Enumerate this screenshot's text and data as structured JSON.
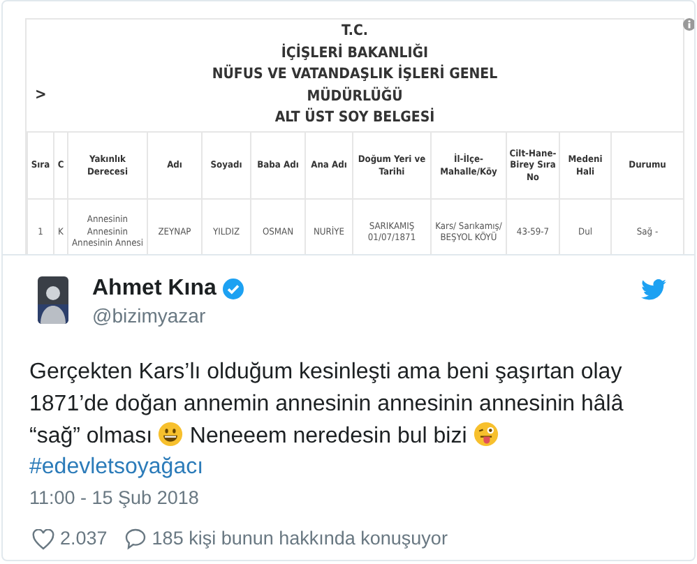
{
  "document": {
    "title_lines": [
      "T.C.",
      "İÇİŞLERİ BAKANLIĞI",
      "NÜFUS VE VATANDAŞLIK İŞLERİ GENEL",
      "MÜDÜRLÜĞÜ",
      "ALT ÜST SOY BELGESİ"
    ],
    "nav": ">",
    "columns": [
      "Sıra",
      "C",
      "Yakınlık Derecesi",
      "Adı",
      "Soyadı",
      "Baba Adı",
      "Ana Adı",
      "Doğum Yeri ve Tarihi",
      "İl-İlçe-Mahalle/Köy",
      "Cilt-Hane-Birey Sıra No",
      "Medeni Hali",
      "Durumu"
    ],
    "rows": [
      [
        "1",
        "K",
        "Annesinin Annesinin Annesinin Annesi",
        "ZEYNAP",
        "YILDIZ",
        "OSMAN",
        "NURİYE",
        "SARIKAMIŞ 01/07/1871",
        "Kars/ Sarıkamış/ BEŞYOL KÖYÜ",
        "43-59-7",
        "Dul",
        "Sağ -"
      ]
    ]
  },
  "tweet": {
    "name": "Ahmet Kına",
    "verified": true,
    "handle": "@bizimyazar",
    "text": [
      {
        "kind": "text",
        "text": "Gerçekten Kars’lı olduğum kesinleşti ama beni şaşırtan olay 1871’de doğan annemin annesinin annesinin annesinin hâlâ “sağ” olması "
      },
      {
        "kind": "grin"
      },
      {
        "kind": "text",
        "text": " Neneeem neredesin bul bizi "
      },
      {
        "kind": "wink"
      }
    ],
    "hashtag": "#edevletsoyağacı",
    "time": "11:00 - 15 Şub 2018",
    "likes": "2.037",
    "replies": "185 kişi bunun hakkında konuşuyor"
  }
}
